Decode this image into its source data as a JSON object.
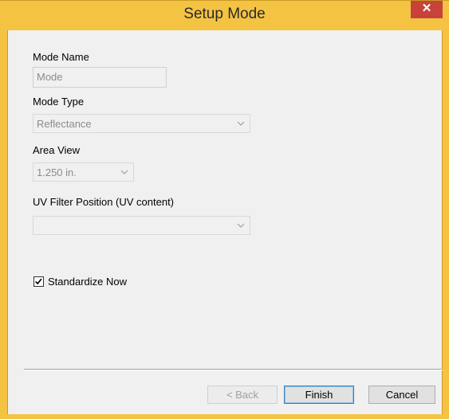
{
  "window": {
    "title": "Setup Mode",
    "close_glyph": "✕"
  },
  "form": {
    "mode_name": {
      "label": "Mode Name",
      "value": "Mode"
    },
    "mode_type": {
      "label": "Mode Type",
      "selected": "Reflectance"
    },
    "area_view": {
      "label": "Area View",
      "selected": "1.250 in."
    },
    "uv_filter": {
      "label": "UV Filter Position (UV content)",
      "selected": ""
    },
    "standardize": {
      "label": "Standardize Now",
      "checked": true
    }
  },
  "buttons": {
    "back": "< Back",
    "finish": "Finish",
    "cancel": "Cancel"
  },
  "icons": {
    "close": "close-icon",
    "dropdown": "chevron-down-icon",
    "check": "checkmark-icon"
  },
  "colors": {
    "title_bar": "#f4c342",
    "close_button": "#c7433a",
    "dialog_background": "#f0f0f0",
    "disabled_text": "#8c8c8c"
  }
}
